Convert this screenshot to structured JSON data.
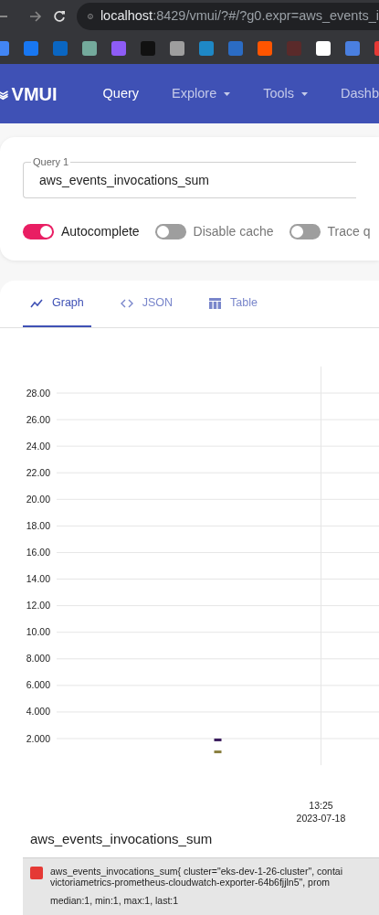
{
  "browser": {
    "url_host": "localhost",
    "url_rest": ":8429/vmui/?#/?g0.expr=aws_events_i"
  },
  "header": {
    "logo": "VMUI",
    "nav": [
      {
        "label": "Query",
        "selected": true,
        "dropdown": false
      },
      {
        "label": "Explore",
        "selected": false,
        "dropdown": true
      },
      {
        "label": "Tools",
        "selected": false,
        "dropdown": true
      },
      {
        "label": "Dashb",
        "selected": false,
        "dropdown": false
      }
    ]
  },
  "query": {
    "label": "Query 1",
    "value": "aws_events_invocations_sum"
  },
  "toggles": [
    {
      "label": "Autocomplete",
      "on": true
    },
    {
      "label": "Disable cache",
      "on": false
    },
    {
      "label": "Trace q",
      "on": false
    }
  ],
  "tabs": [
    {
      "label": "Graph",
      "kind": "graph",
      "selected": true
    },
    {
      "label": "JSON",
      "kind": "code",
      "selected": false
    },
    {
      "label": "Table",
      "kind": "table",
      "selected": false
    }
  ],
  "chart_data": {
    "type": "scatter",
    "grid": true,
    "ylim": [
      0,
      30
    ],
    "yticks": [
      {
        "value": 2,
        "label": "2.000"
      },
      {
        "value": 4,
        "label": "4.000"
      },
      {
        "value": 6,
        "label": "6.000"
      },
      {
        "value": 8,
        "label": "8.000"
      },
      {
        "value": 10,
        "label": "10.00"
      },
      {
        "value": 12,
        "label": "12.00"
      },
      {
        "value": 14,
        "label": "14.00"
      },
      {
        "value": 16,
        "label": "16.00"
      },
      {
        "value": 18,
        "label": "18.00"
      },
      {
        "value": 20,
        "label": "20.00"
      },
      {
        "value": 22,
        "label": "22.00"
      },
      {
        "value": 24,
        "label": "24.00"
      },
      {
        "value": 26,
        "label": "26.00"
      },
      {
        "value": 28,
        "label": "28.00"
      }
    ],
    "annotations": [
      "13:25\n2023-07-18"
    ],
    "series": [
      {
        "color": "#3b1d5e",
        "values": [
          1.9
        ]
      },
      {
        "color": "#8a8040",
        "values": [
          1
        ]
      }
    ]
  },
  "legend": {
    "title": "aws_events_invocations_sum",
    "items": [
      {
        "color": "#e53935",
        "lines": [
          "aws_events_invocations_sum{ cluster=\"eks-dev-1-26-cluster\", contai",
          "victoriametrics-prometheus-cloudwatch-exporter-64b6fjjln5\", prom"
        ],
        "stats": "median:1, min:1, max:1, last:1"
      }
    ]
  }
}
